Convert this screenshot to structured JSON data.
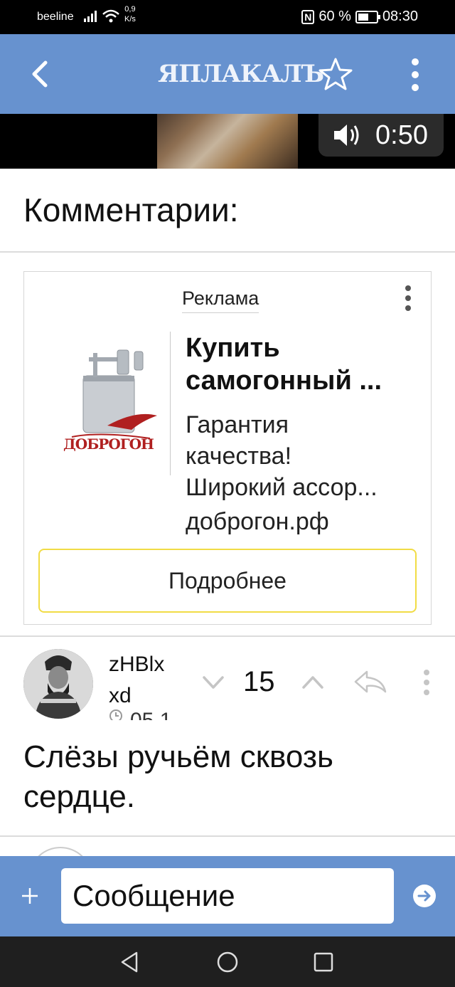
{
  "status": {
    "carrier": "beeline",
    "speed_value": "0,9",
    "speed_unit": "K/s",
    "nfc": "N",
    "battery_percent": "60 %",
    "time": "08:30"
  },
  "header": {
    "logo": "ЯПЛАКАЛЪ",
    "icons": [
      "back-arrow-icon",
      "star-icon",
      "more-vertical-icon"
    ]
  },
  "video": {
    "duration": "0:50",
    "icons": [
      "volume-icon"
    ]
  },
  "comments_title": "Комментарии:",
  "ad": {
    "label": "Реклама",
    "brand_logo": "ДОБРОГОН",
    "title": "Купить самогонный ...",
    "description": "Гарантия\nкачества!\nШирокий ассор...",
    "domain": "доброгон.рф",
    "button_label": "Подробнее"
  },
  "comment": {
    "author_line1": "zHBlx",
    "author_line2": "xd",
    "date_fragment": "05.1",
    "rating": "15",
    "text": "Слёзы ручьём сквозь сердце.",
    "icons": [
      "vote-down-icon",
      "vote-up-icon",
      "reply-icon",
      "more-vertical-icon",
      "clock-icon"
    ]
  },
  "message_bar": {
    "placeholder": "Сообщение",
    "icons": [
      "plus-icon",
      "send-icon"
    ]
  },
  "navbar": {
    "icons": [
      "nav-back-icon",
      "nav-home-icon",
      "nav-recents-icon"
    ]
  },
  "colors": {
    "header_bg": "#6792cf",
    "ad_button_border": "#f1dc45"
  }
}
